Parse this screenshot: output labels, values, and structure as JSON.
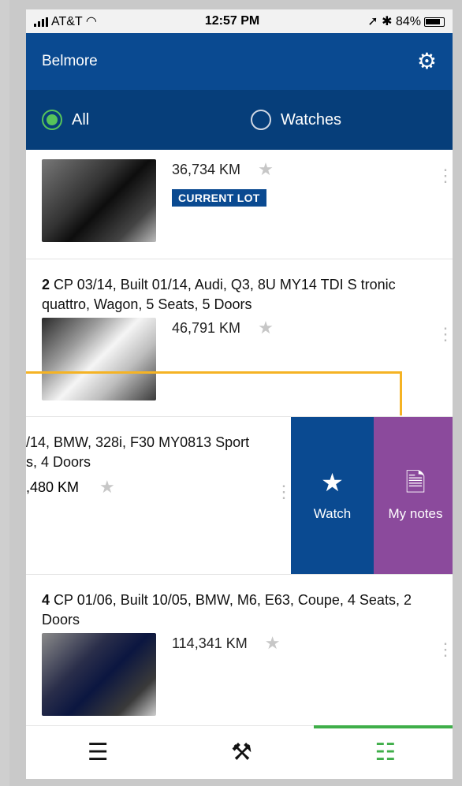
{
  "status": {
    "carrier": "AT&T",
    "time": "12:57 PM",
    "battery": "84%"
  },
  "header": {
    "title": "Belmore"
  },
  "filter": {
    "all_label": "All",
    "watches_label": "Watches"
  },
  "items": [
    {
      "km": "36,734 KM",
      "badge": "CURRENT LOT"
    },
    {
      "lot": "2",
      "title": "CP 03/14, Built 01/14, Audi, Q3, 8U MY14 TDI S tronic quattro, Wagon, 5 Seats, 5 Doors",
      "km": "46,791 KM"
    },
    {
      "line1": "/14, BMW, 328i, F30 MY0813 Sport",
      "line2": "s, 4 Doors",
      "km": ",480 KM"
    },
    {
      "lot": "4",
      "title": "CP 01/06, Built 10/05, BMW, M6, E63, Coupe, 4 Seats, 2 Doors",
      "km": "114,341 KM"
    }
  ],
  "swipe_actions": {
    "watch_label": "Watch",
    "notes_label": "My notes"
  },
  "icons": {
    "gear": "gear-icon",
    "star": "star-icon",
    "note": "note-add-icon",
    "menu": "menu-icon",
    "gavel": "gavel-icon",
    "list": "list-icon"
  }
}
